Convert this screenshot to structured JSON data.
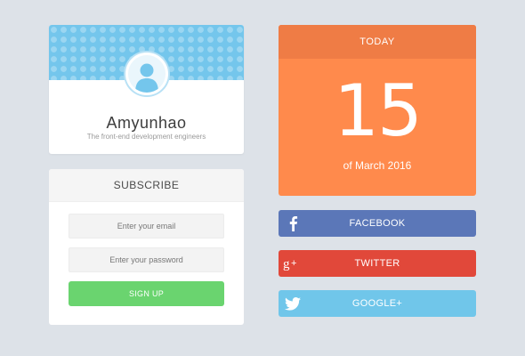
{
  "profile": {
    "name": "Amyunhao",
    "subtitle": "The front-end development engineers",
    "avatar_icon": "user-avatar-icon"
  },
  "subscribe": {
    "title": "SUBSCRIBE",
    "email_placeholder": "Enter your email",
    "password_placeholder": "Enter your password",
    "button_label": "SIGN UP"
  },
  "calendar": {
    "header": "TODAY",
    "day": "15",
    "month_year": "of March 2016"
  },
  "social": [
    {
      "label": "FACEBOOK",
      "icon": "facebook-icon",
      "color": "#5b77b8"
    },
    {
      "label": "TWITTER",
      "icon": "google-plus-icon",
      "color": "#e1483a"
    },
    {
      "label": "GOOGLE+",
      "icon": "twitter-icon",
      "color": "#70c6ea"
    }
  ],
  "colors": {
    "background": "#dde2e8",
    "banner": "#74c6ec",
    "calendar": "#ff8a4c",
    "signup": "#6ad46f"
  }
}
